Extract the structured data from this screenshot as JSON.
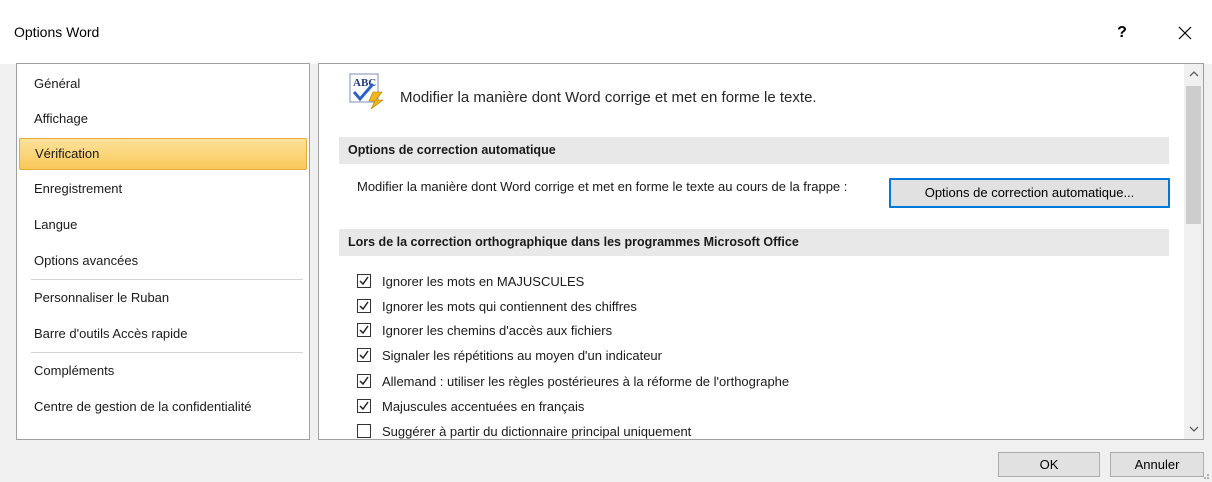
{
  "window": {
    "title": "Options Word",
    "help_label": "?"
  },
  "sidebar": {
    "items": [
      {
        "label": "Général"
      },
      {
        "label": "Affichage"
      },
      {
        "label": "Vérification",
        "selected": true
      },
      {
        "label": "Enregistrement"
      },
      {
        "label": "Langue"
      },
      {
        "label": "Options avancées"
      },
      {
        "label": "Personnaliser le Ruban"
      },
      {
        "label": "Barre d'outils Accès rapide"
      },
      {
        "label": "Compléments"
      },
      {
        "label": "Centre de gestion de la confidentialité"
      }
    ]
  },
  "main": {
    "header": "Modifier la manière dont Word corrige et met en forme le texte.",
    "icon_text": "ABC",
    "section1": {
      "title": "Options de correction automatique",
      "description": "Modifier la manière dont Word corrige et met en forme le texte au cours de la frappe :",
      "button_label": "Options de correction automatique..."
    },
    "section2": {
      "title": "Lors de la correction orthographique dans les programmes Microsoft Office",
      "options": [
        {
          "label": "Ignorer les mots en MAJUSCULES",
          "checked": true
        },
        {
          "label": "Ignorer les mots qui contiennent des chiffres",
          "checked": true
        },
        {
          "label": "Ignorer les chemins d'accès aux fichiers",
          "checked": true
        },
        {
          "label": "Signaler les répétitions au moyen d'un indicateur",
          "checked": true
        },
        {
          "label": "Allemand : utiliser les règles postérieures à la réforme de l'orthographe",
          "checked": true
        },
        {
          "label": "Majuscules accentuées en français",
          "checked": true
        },
        {
          "label": "Suggérer à partir du dictionnaire principal uniquement",
          "checked": false
        }
      ]
    }
  },
  "footer": {
    "ok_label": "OK",
    "cancel_label": "Annuler"
  },
  "colors": {
    "selected_nav": "#f8c95a",
    "focus_border": "#0078d7",
    "section_band": "#e8e8e8"
  }
}
